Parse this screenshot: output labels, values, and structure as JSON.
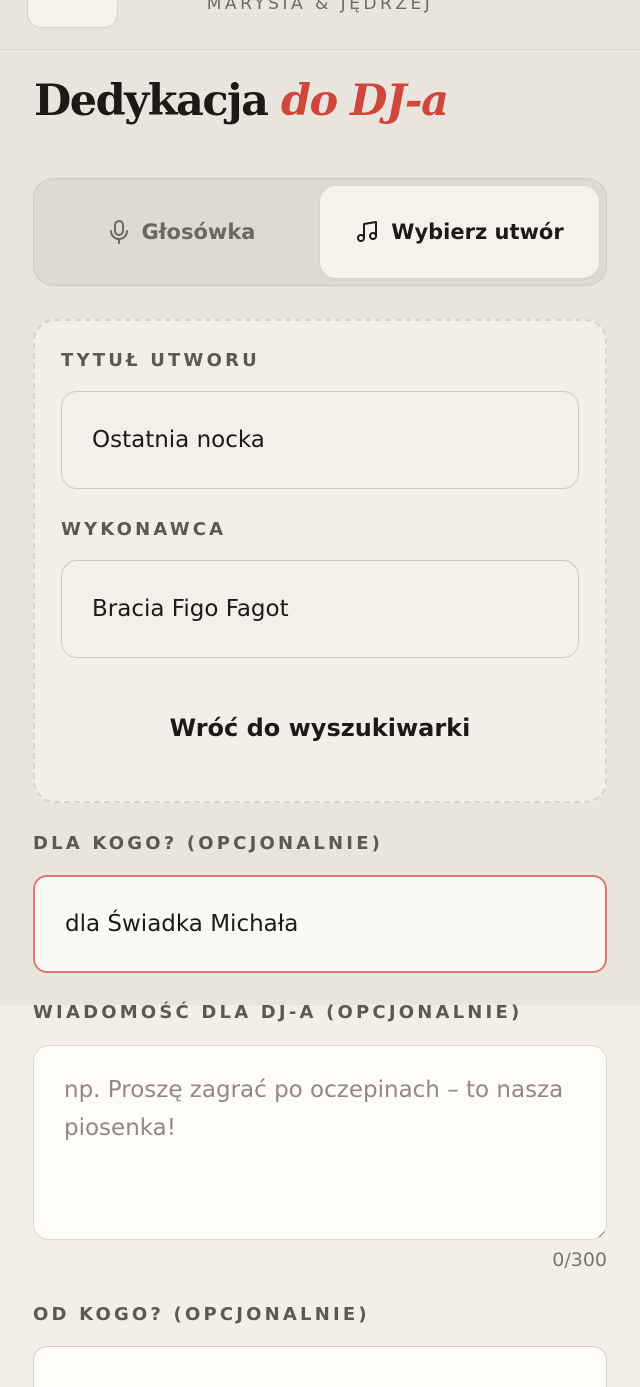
{
  "header": {
    "names": "MARYSIA & JĘDRZEJ"
  },
  "title": {
    "main": "Dedykacja",
    "accent": "do DJ-a"
  },
  "mode_switch": {
    "voice_label": "Głosówka",
    "song_label": "Wybierz utwór",
    "selected": "song"
  },
  "song": {
    "title_label": "TYTUŁ UTWORU",
    "title_value": "Ostatnia nocka",
    "artist_label": "WYKONAWCA",
    "artist_value": "Bracia Figo Fagot",
    "back_to_search": "Wróć do wyszukiwarki"
  },
  "for_whom": {
    "label": "DLA KOGO? (OPCJONALNIE)",
    "value": "dla Świadka Michała"
  },
  "message": {
    "label": "WIADOMOŚĆ DLA DJ-A (OPCJONALNIE)",
    "placeholder": "np. Proszę zagrać po oczepinach – to nasza piosenka!",
    "counter": "0/300"
  },
  "from_whom": {
    "label": "OD KOGO? (OPCJONALNIE)"
  },
  "colors": {
    "accent": "#d0463c",
    "error_border": "#dd7a72"
  }
}
